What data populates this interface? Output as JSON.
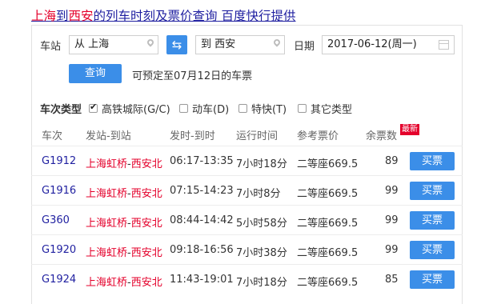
{
  "header": {
    "from": "上海",
    "to_word": "到",
    "to": "西安",
    "rest": "的列车时刻及票价查询",
    "provider": "百度快行提供"
  },
  "search": {
    "station_label": "车站",
    "from_value": "从 上海",
    "to_value": "到 西安",
    "date_label": "日期",
    "date_value": "2017-06-12(周一)",
    "query_label": "查询",
    "note": "可预定至07月12日的车票"
  },
  "filters": {
    "label": "车次类型",
    "options": [
      {
        "label": "高铁城际(G/C)",
        "checked": true
      },
      {
        "label": "动车(D)",
        "checked": false
      },
      {
        "label": "特快(T)",
        "checked": false
      },
      {
        "label": "其它类型",
        "checked": false
      }
    ]
  },
  "table": {
    "columns": [
      "车次",
      "发站-到站",
      "发时-到时",
      "运行时间",
      "参考票价",
      "余票数"
    ],
    "new_badge": "最新",
    "buy_label": "买票",
    "rows": [
      {
        "train": "G1912",
        "from": "上海虹桥",
        "dash": "-",
        "to": "西安北",
        "times": "06:17-13:35",
        "duration": "7小时18分",
        "price": "二等座669.5",
        "tickets": "89"
      },
      {
        "train": "G1916",
        "from": "上海虹桥",
        "dash": "-",
        "to": "西安北",
        "times": "07:15-14:23",
        "duration": "7小时8分",
        "price": "二等座669.5",
        "tickets": "99"
      },
      {
        "train": "G360",
        "from": "上海虹桥",
        "dash": "-",
        "to": "西安北",
        "times": "08:44-14:42",
        "duration": "5小时58分",
        "price": "二等座669.5",
        "tickets": "99"
      },
      {
        "train": "G1920",
        "from": "上海虹桥",
        "dash": "-",
        "to": "西安北",
        "times": "09:18-16:56",
        "duration": "7小时38分",
        "price": "二等座669.5",
        "tickets": "99"
      },
      {
        "train": "G1924",
        "from": "上海虹桥",
        "dash": "-",
        "to": "西安北",
        "times": "11:43-19:01",
        "duration": "7小时18分",
        "price": "二等座669.5",
        "tickets": "85"
      }
    ]
  },
  "colors": {
    "accent": "#3b8ee8",
    "red": "#e4002b",
    "link": "#1f1fa0"
  }
}
